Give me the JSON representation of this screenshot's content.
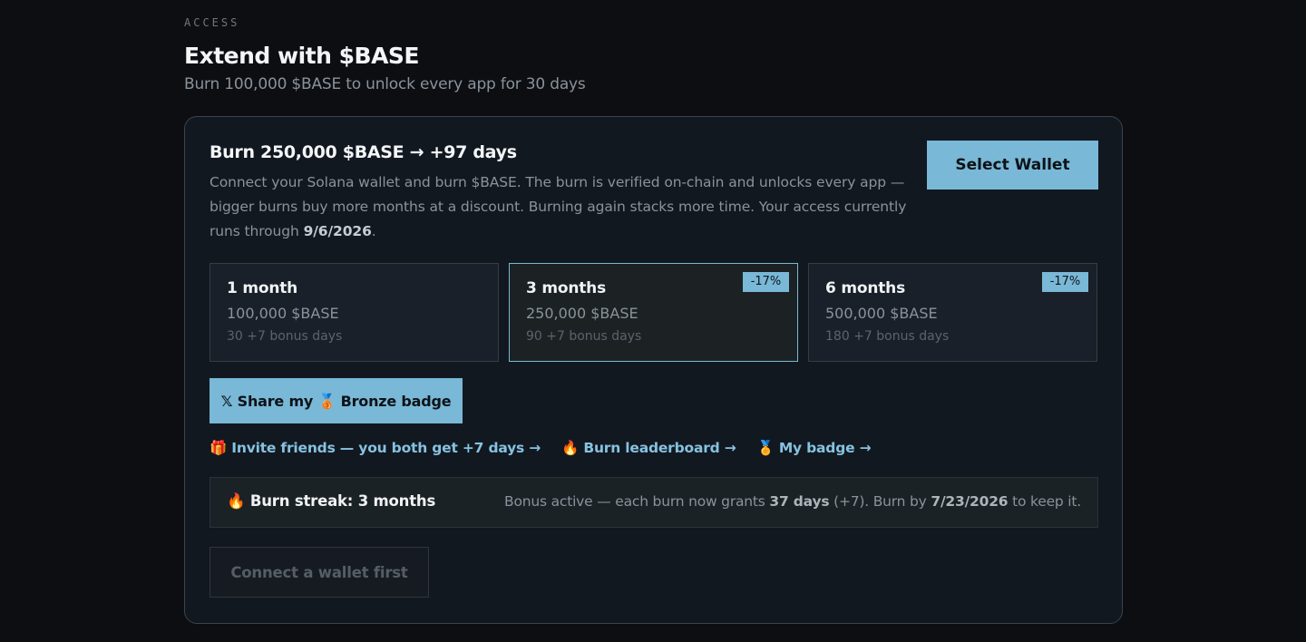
{
  "section": {
    "eyebrow": "ACCESS",
    "title": "Extend with $BASE",
    "subtitle": "Burn 100,000 $BASE to unlock every app for 30 days"
  },
  "card": {
    "burn_title": "Burn 250,000 $BASE → +97 days",
    "description_lead": "Connect your Solana wallet and burn $BASE. The burn is verified on-chain and unlocks every app — bigger burns buy more months at a discount. Burning again stacks more time. Your access currently runs through ",
    "access_until": "9/6/2026",
    "description_end": ".",
    "select_wallet_label": "Select Wallet"
  },
  "plans": [
    {
      "name": "1 month",
      "price": "100,000 $BASE",
      "bonus": "30 +7 bonus days",
      "discount": "",
      "selected": false
    },
    {
      "name": "3 months",
      "price": "250,000 $BASE",
      "bonus": "90 +7 bonus days",
      "discount": "-17%",
      "selected": true
    },
    {
      "name": "6 months",
      "price": "500,000 $BASE",
      "bonus": "180 +7 bonus days",
      "discount": "-17%",
      "selected": false
    }
  ],
  "share_badge_label": "𝕏 Share my 🥉 Bronze badge",
  "links": [
    {
      "label": "🎁 Invite friends — you both get +7 days →"
    },
    {
      "label": "🔥 Burn leaderboard →"
    },
    {
      "label": "🏅 My badge →"
    }
  ],
  "streak": {
    "title": "🔥 Burn streak: 3 months",
    "info_lead": "Bonus active — each burn now grants ",
    "grant_days": "37 days",
    "info_mid": " (+7). Burn by ",
    "deadline": "7/23/2026",
    "info_end": " to keep it."
  },
  "connect_first_label": "Connect a wallet first",
  "colors": {
    "accent": "#79b8d6",
    "link": "#86c2e0",
    "background": "#0c0e11",
    "card": "#121820"
  }
}
